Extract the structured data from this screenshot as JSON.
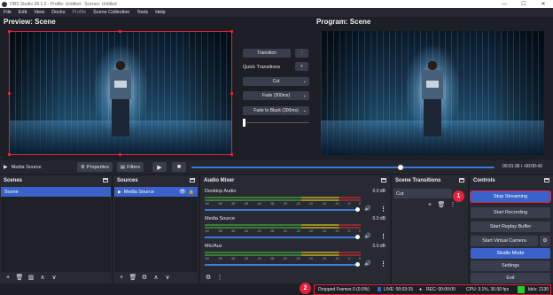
{
  "window": {
    "title": "OBS Studio 28.1.2 - Profile: Untitled - Scenes: Untitled",
    "controls": [
      "—",
      "☐",
      "✕"
    ]
  },
  "menu": [
    "File",
    "Edit",
    "View",
    "Docks",
    "Profile",
    "Scene Collection",
    "Tools",
    "Help"
  ],
  "preview": {
    "label": "Preview: Scene"
  },
  "program": {
    "label": "Program: Scene"
  },
  "transitions": {
    "transition_button": "Transition",
    "more_icon": "⋮",
    "quick_label": "Quick Transitions",
    "add_icon": "+",
    "selects": [
      "Cut",
      "Fade (300ms)",
      "Fade to Black (300ms)"
    ]
  },
  "source_toolbar": {
    "source_name": "Media Source",
    "properties": "Properties",
    "filters": "Filters",
    "timecode": "00:01:36 / -00:00:43",
    "progress": 0.69
  },
  "scenes": {
    "title": "Scenes",
    "items": [
      "Scene"
    ]
  },
  "sources": {
    "title": "Sources",
    "items": [
      {
        "name": "Media Source",
        "visible": true,
        "locked": true
      }
    ]
  },
  "mixer": {
    "title": "Audio Mixer",
    "ticks": [
      "-60",
      "-55",
      "-50",
      "-45",
      "-40",
      "-35",
      "-30",
      "-25",
      "-20",
      "-15",
      "-10",
      "-5",
      "0"
    ],
    "channels": [
      {
        "name": "Desktop Audio",
        "db": "0.0 dB"
      },
      {
        "name": "Media Source",
        "db": "0.0 dB"
      },
      {
        "name": "Mic/Aux",
        "db": "0.0 dB"
      }
    ]
  },
  "scene_transitions": {
    "title": "Scene Transitions",
    "selected": "Cut"
  },
  "controls": {
    "title": "Controls",
    "buttons": [
      "Stop Streaming",
      "Start Recording",
      "Start Replay Buffer",
      "Start Virtual Camera",
      "Studio Mode",
      "Settings",
      "Exit"
    ]
  },
  "status": {
    "dropped": "Dropped Frames 0 (0.0%)",
    "live": "LIVE: 00:03:15",
    "rec": "REC: 00:00:00",
    "cpu": "CPU: 3.1%, 30.00 fps",
    "kbps": "kb/s: 2130"
  },
  "badges": [
    "1",
    "2"
  ],
  "colors": {
    "accent_blue": "#3a62c9",
    "highlight_red": "#e8203a",
    "status_green": "#1fd12f"
  }
}
